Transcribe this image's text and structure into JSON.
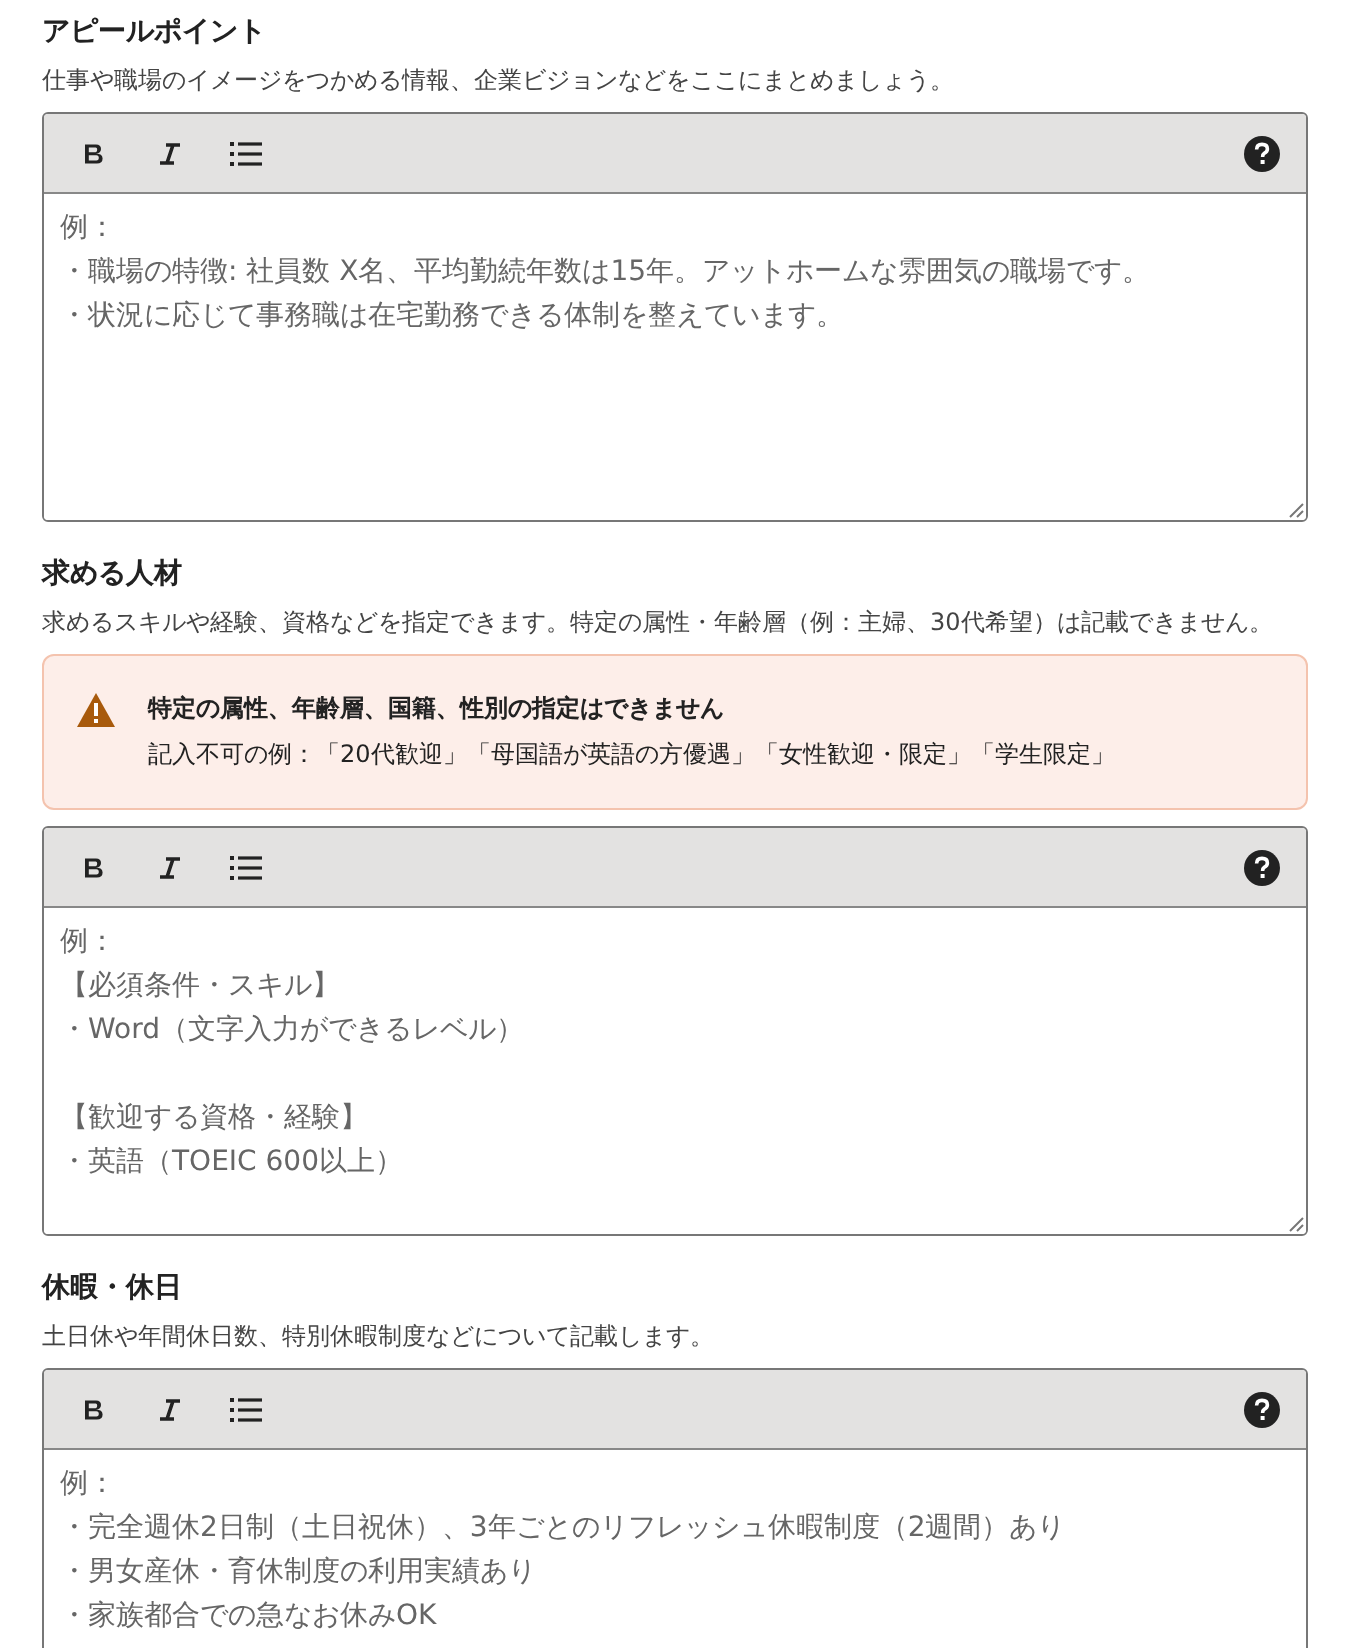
{
  "sections": [
    {
      "title": "アピールポイント",
      "description": "仕事や職場のイメージをつかめる情報、企業ビジョンなどをここにまとめましょう。",
      "editor": {
        "resize_handle": true,
        "placeholder": [
          {
            "text": "例："
          },
          {
            "text": "・職場の特徴: 社員数 X名、平均勤続年数は15年。アットホームな雰囲気の職場です。"
          },
          {
            "text": "・状況に応じて事務職は在宅勤務できる体制を整えています。"
          }
        ]
      }
    },
    {
      "title": "求める人材",
      "description": "求めるスキルや経験、資格などを指定できます。特定の属性・年齢層（例：主婦、30代希望）は記載できません。",
      "warning": {
        "title": "特定の属性、年齢層、国籍、性別の指定はできません",
        "body": "記入不可の例：「20代歓迎」「母国語が英語の方優遇」「女性歓迎・限定」「学生限定」"
      },
      "editor": {
        "resize_handle": true,
        "placeholder": [
          {
            "text": "例："
          },
          {
            "text": "【必須条件・スキル】"
          },
          {
            "text": "・Word（文字入力ができるレベル）"
          },
          {
            "text": "【歓迎する資格・経験】",
            "gap_before": true
          },
          {
            "text": "・英語（TOEIC 600以上）"
          }
        ]
      }
    },
    {
      "title": "休暇・休日",
      "description": "土日休や年間休日数、特別休暇制度などについて記載します。",
      "editor": {
        "placeholder": [
          {
            "text": "例："
          },
          {
            "text": "・完全週休2日制（土日祝休）、3年ごとのリフレッシュ休暇制度（2週間）あり"
          },
          {
            "text": "・男女産休・育休制度の利用実績あり"
          },
          {
            "text": "・家族都合での急なお休みOK"
          }
        ]
      }
    }
  ]
}
